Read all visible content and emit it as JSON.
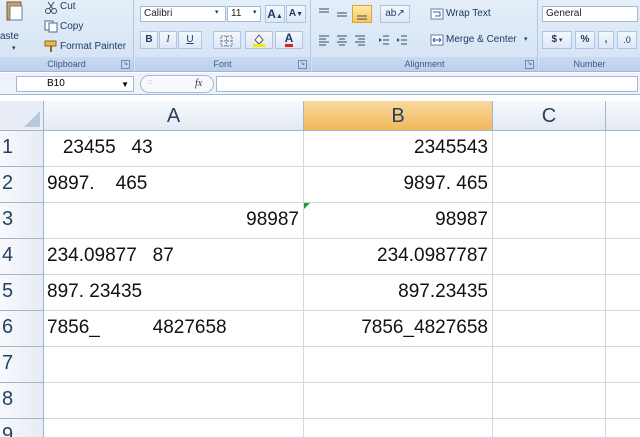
{
  "ribbon": {
    "clipboard": {
      "paste_label": "aste",
      "cut_label": "Cut",
      "copy_label": "Copy",
      "format_painter_label": "Format Painter",
      "group_label": "Clipboard"
    },
    "font": {
      "font_name": "Calibri",
      "font_size": "11",
      "grow_label": "A",
      "shrink_label": "A",
      "bold_label": "B",
      "italic_label": "I",
      "underline_label": "U",
      "font_color_label": "A",
      "group_label": "Font"
    },
    "alignment": {
      "wrap_text_label": "Wrap Text",
      "merge_center_label": "Merge & Center",
      "group_label": "Alignment"
    },
    "number": {
      "format_value": "General",
      "currency_label": "$",
      "percent_label": "%",
      "comma_label": ",",
      "increase_decimal_label": ".0",
      "group_label": "Number"
    },
    "colors": {
      "highlight": "#f7e800",
      "font_color": "#e02020",
      "active_button": "#f7c65a"
    }
  },
  "formula_bar": {
    "name_box": "B10",
    "fx_label": "fx",
    "formula_value": ""
  },
  "sheet": {
    "columns": [
      "A",
      "B",
      "C"
    ],
    "selected_column": "B",
    "row_numbers": [
      "1",
      "2",
      "3",
      "4",
      "5",
      "6",
      "7",
      "8",
      "9"
    ],
    "rows": [
      {
        "a": "   23455   43",
        "b": "2345543"
      },
      {
        "a": "9897.    465",
        "b": "9897. 465"
      },
      {
        "a": "98987",
        "b": "98987"
      },
      {
        "a": "234.09877   87",
        "b": "234.0987787"
      },
      {
        "a": "897. 23435",
        "b": "897.23435"
      },
      {
        "a": "7856_          4827658",
        "b": "7856_4827658"
      },
      {
        "a": "",
        "b": ""
      },
      {
        "a": "",
        "b": ""
      },
      {
        "a": "",
        "b": ""
      }
    ],
    "error_indicator_color": "#1e9b3a"
  }
}
